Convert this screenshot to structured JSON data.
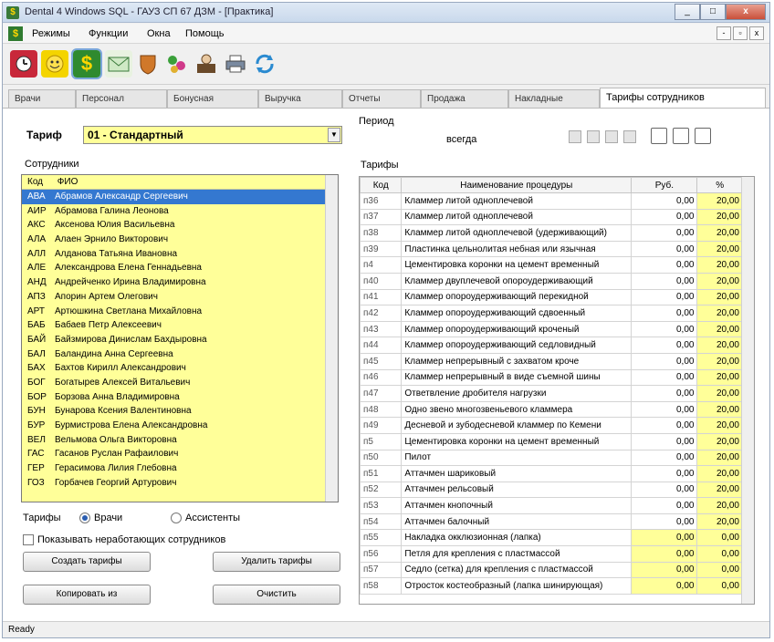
{
  "window": {
    "title": "Dental 4 Windows SQL - ГАУЗ СП 67 ДЗМ - [Практика]",
    "min_label": "_",
    "max_label": "□",
    "close_label": "x"
  },
  "menu": {
    "items": [
      "Режимы",
      "Функции",
      "Окна",
      "Помощь"
    ],
    "mdi_min": "-",
    "mdi_restore": "▫",
    "mdi_close": "x"
  },
  "toolbar": {
    "icons": [
      "clock-icon",
      "smiley-icon",
      "dollar-icon",
      "envelope-icon",
      "shield-icon",
      "pills-icon",
      "cashier-icon",
      "printer-icon",
      "refresh-icon"
    ],
    "active_index": 2
  },
  "tabs": [
    "Врачи",
    "Персонал",
    "Бонусная",
    "Выручка",
    "Отчеты",
    "Продажа",
    "Накладные",
    "Тарифы сотрудников"
  ],
  "active_tab": 7,
  "left": {
    "tariff_label": "Тариф",
    "tariff_value": "01 - Стандартный",
    "employees_label": "Сотрудники",
    "col_code": "Код",
    "col_fio": "ФИО",
    "employees": [
      {
        "code": "АВА",
        "name": "Абрамов Александр Сергеевич",
        "selected": true
      },
      {
        "code": "АИР",
        "name": "Абрамова Галина Леонова"
      },
      {
        "code": "АКС",
        "name": "Аксенова Юлия Васильевна"
      },
      {
        "code": "АЛА",
        "name": "Алаен Эрнило Викторович"
      },
      {
        "code": "АЛЛ",
        "name": "Алданова Татьяна Ивановна"
      },
      {
        "code": "АЛЕ",
        "name": "Александрова Елена Геннадьевна"
      },
      {
        "code": "АНД",
        "name": "Андрейченко Ирина Владимировна"
      },
      {
        "code": "АПЗ",
        "name": "Апорин Артем Олегович"
      },
      {
        "code": "АРТ",
        "name": "Артюшкина Светлана Михайловна"
      },
      {
        "code": "БАБ",
        "name": "Бабаев Петр Алексеевич"
      },
      {
        "code": "БАЙ",
        "name": "Байзмирова Динислам Бахдыровна"
      },
      {
        "code": "БАЛ",
        "name": "Баландина Анна Сергеевна"
      },
      {
        "code": "БАХ",
        "name": "Бахтов Кирилл Александрович"
      },
      {
        "code": "БОГ",
        "name": "Богатырев Алексей Витальевич"
      },
      {
        "code": "БОР",
        "name": "Борзова Анна Владимировна"
      },
      {
        "code": "БУН",
        "name": "Бунарова Ксения Валентиновна"
      },
      {
        "code": "БУР",
        "name": "Бурмистрова Елена Александровна"
      },
      {
        "code": "ВЕЛ",
        "name": "Вельмова Ольга Викторовна"
      },
      {
        "code": "ГАС",
        "name": "Гасанов Руслан Рафаилович"
      },
      {
        "code": "ГЕР",
        "name": "Герасимова Лилия Глебовна"
      },
      {
        "code": "ГОЗ",
        "name": "Горбачев Георгий Артурович"
      }
    ],
    "radio_label": "Тарифы",
    "radio_doctors": "Врачи",
    "radio_assistants": "Ассистенты",
    "checkbox_label": "Показывать неработающих сотрудников",
    "btn_create": "Создать тарифы",
    "btn_delete": "Удалить тарифы",
    "btn_copy": "Копировать из",
    "btn_clear": "Очистить"
  },
  "right": {
    "period_label": "Период",
    "period_value": "всегда",
    "tariffs_label": "Тарифы",
    "col_code": "Код",
    "col_name": "Наименование процедуры",
    "col_rub": "Руб.",
    "col_pct": "%",
    "rows": [
      {
        "code": "п36",
        "name": "Кламмер литой одноплечевой",
        "rub": "0,00",
        "pct": "20,00"
      },
      {
        "code": "п37",
        "name": "Кламмер литой одноплечевой",
        "rub": "0,00",
        "pct": "20,00"
      },
      {
        "code": "п38",
        "name": "Кламмер литой одноплечевой (удерживающий)",
        "rub": "0,00",
        "pct": "20,00"
      },
      {
        "code": "п39",
        "name": "Пластинка цельнолитая небная или язычная",
        "rub": "0,00",
        "pct": "20,00"
      },
      {
        "code": "п4",
        "name": "Цементировка коронки на цемент временный",
        "rub": "0,00",
        "pct": "20,00"
      },
      {
        "code": "п40",
        "name": "Кламмер двуплечевой опороудерживающий",
        "rub": "0,00",
        "pct": "20,00"
      },
      {
        "code": "п41",
        "name": "Кламмер опороудерживающий перекидной",
        "rub": "0,00",
        "pct": "20,00"
      },
      {
        "code": "п42",
        "name": "Кламмер опороудерживающий сдвоенный",
        "rub": "0,00",
        "pct": "20,00"
      },
      {
        "code": "п43",
        "name": "Кламмер опороудерживающий кроченый",
        "rub": "0,00",
        "pct": "20,00"
      },
      {
        "code": "п44",
        "name": "Кламмер опороудерживающий седловидный",
        "rub": "0,00",
        "pct": "20,00"
      },
      {
        "code": "п45",
        "name": "Кламмер непрерывный с захватом кроче",
        "rub": "0,00",
        "pct": "20,00"
      },
      {
        "code": "п46",
        "name": "Кламмер непрерывный в виде съемной шины",
        "rub": "0,00",
        "pct": "20,00"
      },
      {
        "code": "п47",
        "name": "Ответвление дробителя нагрузки",
        "rub": "0,00",
        "pct": "20,00"
      },
      {
        "code": "п48",
        "name": "Одно звено многозвеньевого кламмера",
        "rub": "0,00",
        "pct": "20,00"
      },
      {
        "code": "п49",
        "name": "Десневой и зубодесневой кламмер по Кемени",
        "rub": "0,00",
        "pct": "20,00"
      },
      {
        "code": "п5",
        "name": "Цементировка коронки на цемент временный",
        "rub": "0,00",
        "pct": "20,00"
      },
      {
        "code": "п50",
        "name": "Пилот",
        "rub": "0,00",
        "pct": "20,00"
      },
      {
        "code": "п51",
        "name": "Аттачмен шариковый",
        "rub": "0,00",
        "pct": "20,00"
      },
      {
        "code": "п52",
        "name": "Аттачмен рельсовый",
        "rub": "0,00",
        "pct": "20,00"
      },
      {
        "code": "п53",
        "name": "Аттачмен кнопочный",
        "rub": "0,00",
        "pct": "20,00"
      },
      {
        "code": "п54",
        "name": "Аттачмен балочный",
        "rub": "0,00",
        "pct": "20,00"
      },
      {
        "code": "п55",
        "name": "Накладка окклюзионная (лапка)",
        "rub": "0,00",
        "pct": "0,00"
      },
      {
        "code": "п56",
        "name": "Петля для крепления с пластмассой",
        "rub": "0,00",
        "pct": "0,00"
      },
      {
        "code": "п57",
        "name": "Седло (сетка) для крепления с пластмассой",
        "rub": "0,00",
        "pct": "0,00"
      },
      {
        "code": "п58",
        "name": "Отросток костеобразный (лапка шинирующая)",
        "rub": "0,00",
        "pct": "0,00"
      }
    ]
  },
  "status": {
    "text": "Ready"
  },
  "colors": {
    "yellow": "#ffff99",
    "selection": "#3478d0"
  }
}
